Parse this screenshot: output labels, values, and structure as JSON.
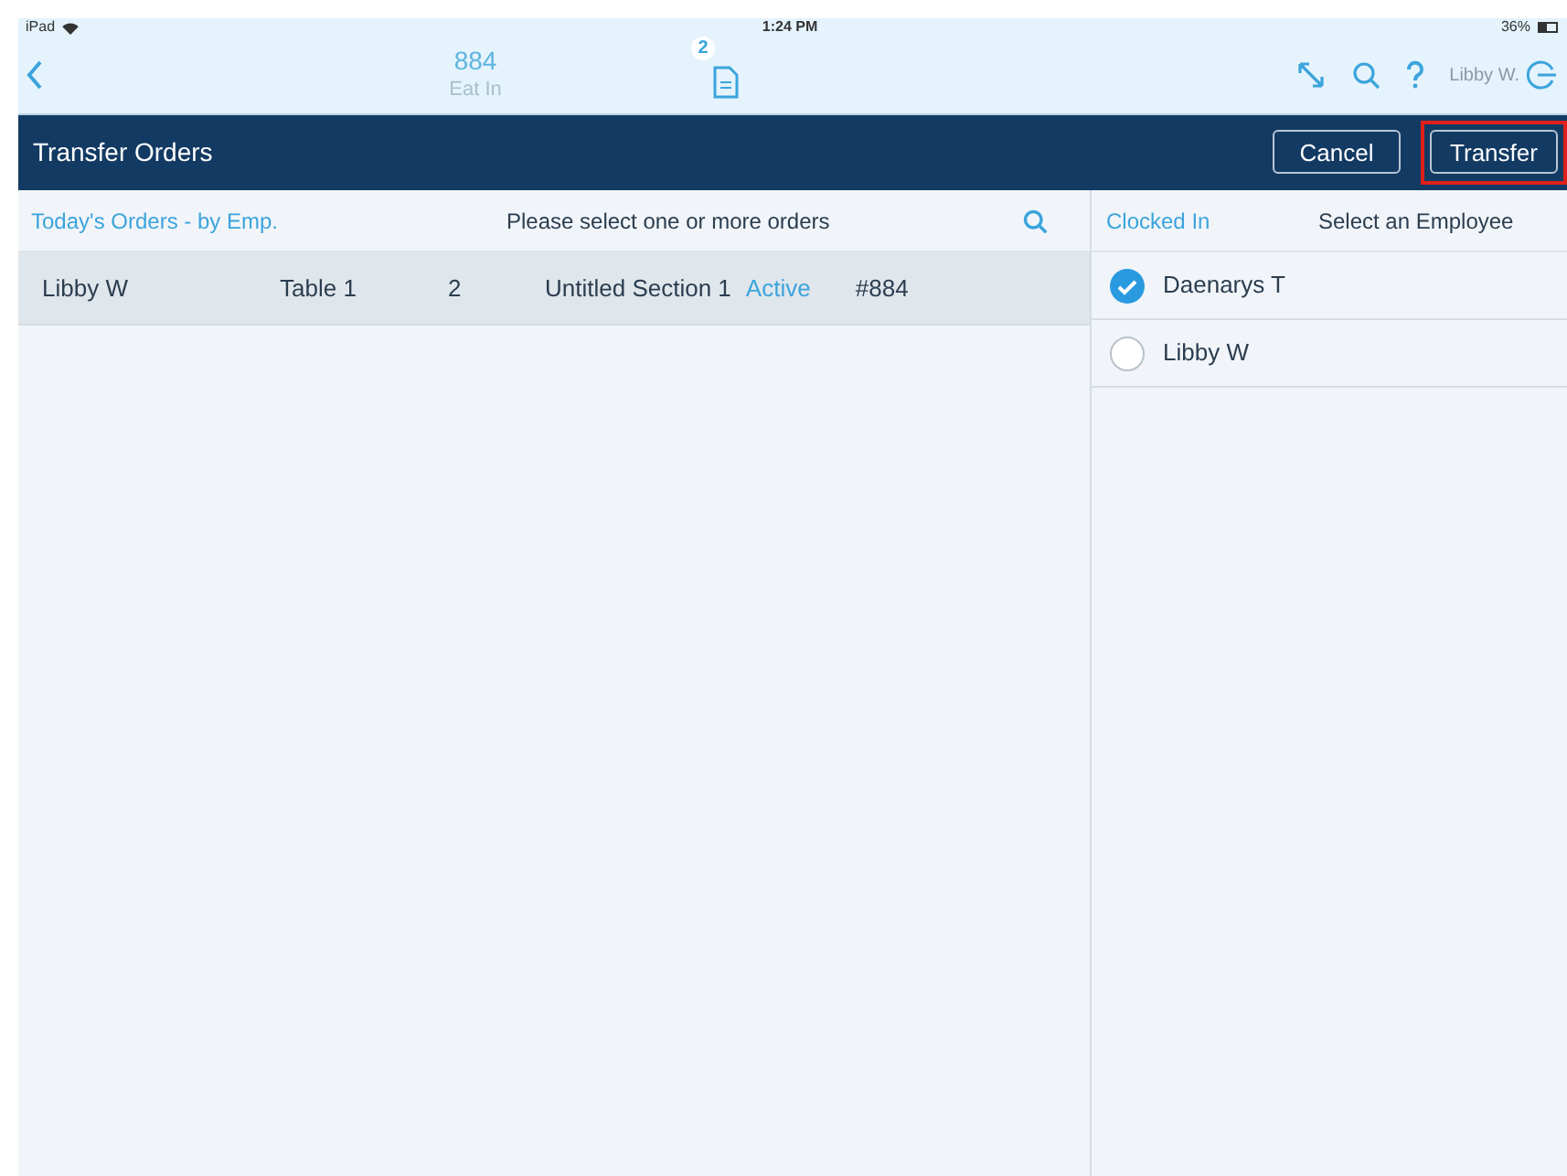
{
  "status_bar": {
    "device": "iPad",
    "time": "1:24 PM",
    "battery": "36%"
  },
  "nav": {
    "order_number": "884",
    "order_type": "Eat In",
    "badge": "2",
    "user": "Libby W."
  },
  "header": {
    "title": "Transfer Orders",
    "buttons": [
      {
        "label": "Cancel",
        "highlighted": false
      },
      {
        "label": "Transfer",
        "highlighted": true
      }
    ]
  },
  "orders": {
    "filter": "Today's Orders - by Emp.",
    "prompt": "Please select one or more orders",
    "rows": [
      {
        "employee": "Libby W",
        "table": "Table 1",
        "guests": "2",
        "section": "Untitled Section 1",
        "status": "Active",
        "number": "#884",
        "selected": true
      }
    ]
  },
  "employees": {
    "filter": "Clocked In",
    "prompt": "Select an Employee",
    "items": [
      {
        "name": "Daenarys T",
        "selected": true
      },
      {
        "name": "Libby W",
        "selected": false
      }
    ]
  }
}
